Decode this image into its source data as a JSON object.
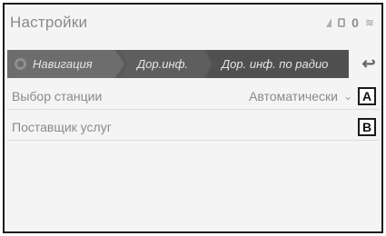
{
  "header": {
    "title": "Настройки",
    "status": {
      "indicator": "0",
      "icons": [
        "signal-icon",
        "lock-icon",
        "wifi-icon"
      ]
    }
  },
  "tabs": [
    {
      "label": "Навигация",
      "icon": "home-icon"
    },
    {
      "label": "Дор.инф."
    },
    {
      "label": "Дор. инф. по радио"
    }
  ],
  "back_icon": "↩",
  "rows": [
    {
      "label": "Выбор станции",
      "value": "Автоматически",
      "callout": "A"
    },
    {
      "label": "Поставщик услуг",
      "callout": "B"
    }
  ]
}
